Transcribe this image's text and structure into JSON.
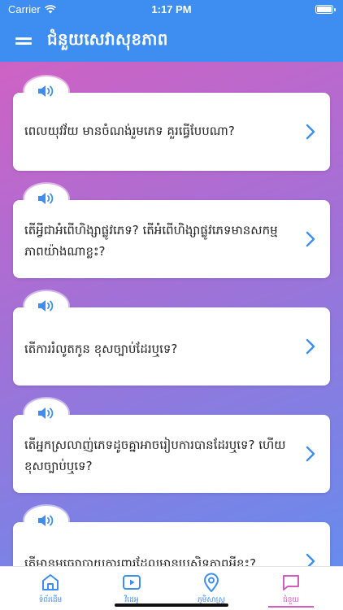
{
  "status_bar": {
    "carrier": "Carrier",
    "time": "1:17 PM"
  },
  "header": {
    "title": "ជំនួយសេវាសុខភាព",
    "menu_icon": "menu-icon"
  },
  "questions": [
    {
      "text": "ពេលយុវវ័យ មានចំណង់រួមភេទ គួរធ្វើបែបណា?"
    },
    {
      "text": "តើអ្វីជាអំពើហិង្សាផ្លូវភេទ? តើអំពើហិង្សាផ្លូវភេទមានសកម្មភាពយ៉ាងណាខ្លះ?"
    },
    {
      "text": "តើការរំលូតកូន ខុសច្បាប់ដែរឬទេ?"
    },
    {
      "text": "តើអ្នកស្រលាញ់ភេទដូចគ្នាអាចរៀបការបានដែរឬទេ? ហើយខុសច្បាប់ឬទេ?"
    },
    {
      "text": "តើមានមធ្យោបាយការពារដែលមានប្រសិទ្ធភាពអ្វីខ្លះ?"
    }
  ],
  "tabs": [
    {
      "label": "ទំព័រដើម",
      "icon": "home-icon"
    },
    {
      "label": "វីដេអូ",
      "icon": "video-icon"
    },
    {
      "label": "ភូមិសាស្ត្រ",
      "icon": "location-icon"
    },
    {
      "label": "ជំនួយ",
      "icon": "chat-icon"
    }
  ],
  "colors": {
    "primary": "#3d8ef0",
    "accent": "#d55bbd",
    "gradient_start": "#d85fc0",
    "gradient_end": "#5f8ff0"
  }
}
